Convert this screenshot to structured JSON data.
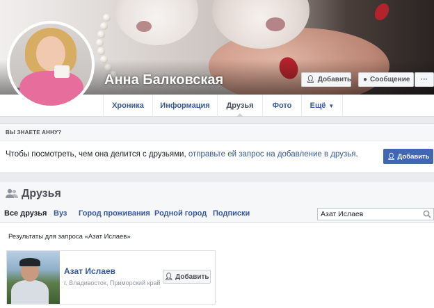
{
  "profile": {
    "name": "Анна Балковская",
    "add_friend_label": "Добавить",
    "message_label": "Сообщение",
    "more_label": "···"
  },
  "tabs": [
    {
      "label": "Хроника"
    },
    {
      "label": "Информация"
    },
    {
      "label": "Друзья"
    },
    {
      "label": "Фото"
    },
    {
      "label": "Ещё"
    }
  ],
  "know": {
    "heading": "ВЫ ЗНАЕТЕ АННУ?",
    "text_before": "Чтобы посмотреть, чем она делится с друзьями, ",
    "link_text": "отправьте ей запрос на добавление в друзья",
    "text_after": ".",
    "button_label": "Добавить"
  },
  "friends": {
    "title": "Друзья",
    "subtabs": [
      {
        "label": "Все друзья"
      },
      {
        "label": "Вуз"
      },
      {
        "label": "Город проживания"
      },
      {
        "label": "Родной город"
      },
      {
        "label": "Подписки"
      }
    ],
    "search_value": "Азат Ислаев",
    "results_label": "Результаты для запроса «Азат Ислаев»",
    "results": [
      {
        "name": "Азат Ислаев",
        "location": "г. Владивосток, Приморский край",
        "button_label": "Добавить"
      }
    ]
  },
  "colors": {
    "link": "#365899",
    "primary_button": "#4267b2",
    "page_bg": "#e9ebee"
  }
}
